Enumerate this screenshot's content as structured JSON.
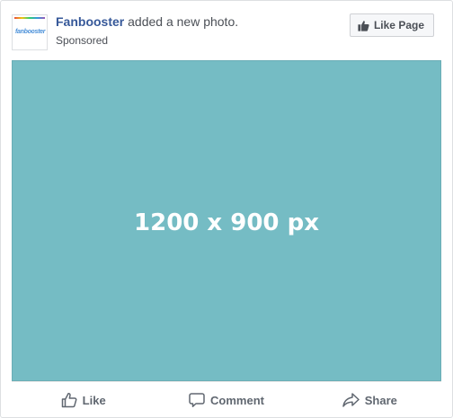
{
  "post": {
    "page_name": "Fanbooster",
    "action_text": " added a new photo.",
    "sponsored_label": "Sponsored",
    "avatar_logo_text": "fanbooster"
  },
  "header": {
    "like_page_label": "Like Page",
    "like_page_icon": "thumbs-up-icon"
  },
  "photo": {
    "placeholder_text": "1200 x 900 px",
    "background_color": "#75bcc4"
  },
  "actions": {
    "like_label": "Like",
    "like_icon": "thumbs-up-outline-icon",
    "comment_label": "Comment",
    "comment_icon": "speech-bubble-icon",
    "share_label": "Share",
    "share_icon": "share-arrow-icon"
  },
  "colors": {
    "page_name": "#365899",
    "text_secondary": "#4b4f56",
    "action_text": "#606770"
  }
}
